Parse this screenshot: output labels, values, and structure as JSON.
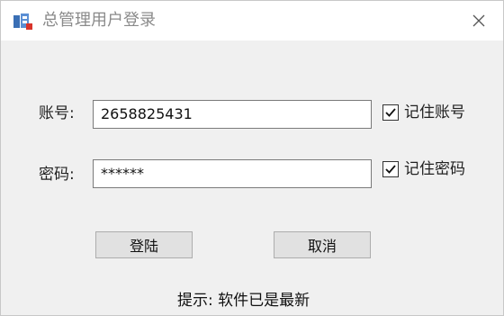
{
  "window": {
    "title": "总管理用户登录",
    "close_icon": "close-icon",
    "app_icon": "app-icon"
  },
  "form": {
    "account_label": "账号:",
    "account_value": "2658825431",
    "password_label": "密码:",
    "password_value": "******",
    "remember_account_label": "记住账号",
    "remember_account_checked": true,
    "remember_password_label": "记住密码",
    "remember_password_checked": true
  },
  "buttons": {
    "login_label": "登陆",
    "cancel_label": "取消"
  },
  "status": {
    "text": "提示: 软件已是最新"
  },
  "colors": {
    "window_bg": "#f0f0f0",
    "titlebar_bg": "#ffffff",
    "title_text": "#8a8a8a",
    "button_bg": "#e1e1e1"
  }
}
